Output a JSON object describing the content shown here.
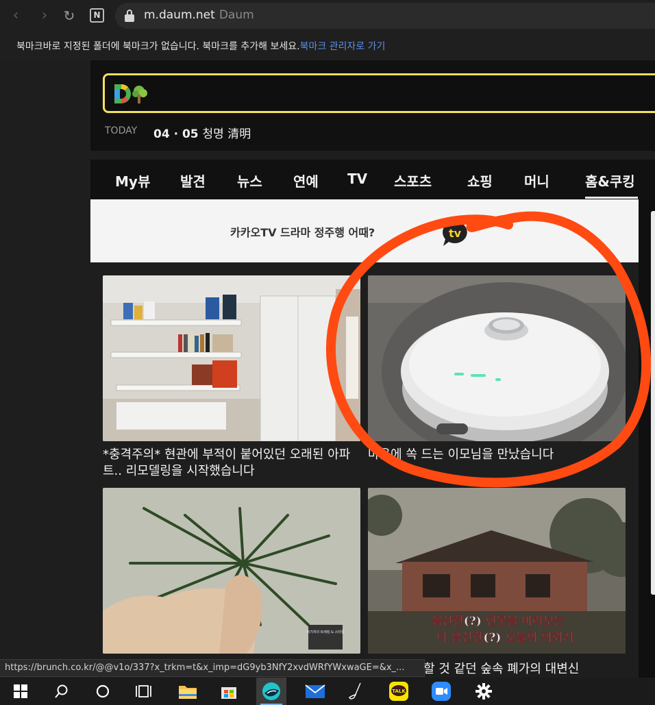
{
  "browser": {
    "url": "m.daum.net",
    "site_name": "Daum",
    "bookmark_bar_text": "북마크바로 지정된 폴더에 북마크가 없습니다. 북마크를 추가해 보세요.",
    "bookmark_bar_link": "북마크 관리자로 가기",
    "naver_button": "N",
    "status_url": "https://brunch.co.kr/@@v1o/337?x_trkm=t&x_imp=dG9yb3NfY2xvdWRfYWxwaGE=&x_..."
  },
  "header": {
    "today_label": "TODAY",
    "date": "04 · 05",
    "solar_term": "청명 清明"
  },
  "nav_tabs": [
    {
      "label": "My뷰"
    },
    {
      "label": "발견"
    },
    {
      "label": "뉴스"
    },
    {
      "label": "연예"
    },
    {
      "label": "TV"
    },
    {
      "label": "스포츠"
    },
    {
      "label": "쇼핑"
    },
    {
      "label": "머니"
    },
    {
      "label": "홈&쿠킹"
    }
  ],
  "active_tab": "홈&쿠킹",
  "banner": {
    "text": "카카오TV 드라마 정주행 어때?",
    "logo_text": "tv"
  },
  "cards": [
    {
      "caption": "*충격주의* 현관에 부적이 붙어있던 오래된 아파트.. 리모델링을 시작했습니다"
    },
    {
      "caption": "마음에 쏙 드는 이모님을 만났습니다"
    },
    {
      "caption": "",
      "thumb_text": "취기자의 트레킹 & 스타일"
    },
    {
      "caption": "할 것 같던 숲속 폐가의 대변신",
      "overlay_line1": "음산한(?) 연못을 바라보는",
      "overlay_line2": "더 음산한(?) 오늘의 의뢰지"
    }
  ],
  "colors": {
    "search_border": "#f6e05b",
    "annotation": "#ff4a12",
    "link": "#5d8fe6"
  },
  "taskbar": {
    "icons": [
      "windows-start",
      "search",
      "cortana",
      "task-view",
      "file-explorer",
      "store",
      "whale-browser",
      "mail",
      "pen",
      "kakaotalk",
      "zoom",
      "settings"
    ],
    "kakaotalk_label": "TALK"
  }
}
